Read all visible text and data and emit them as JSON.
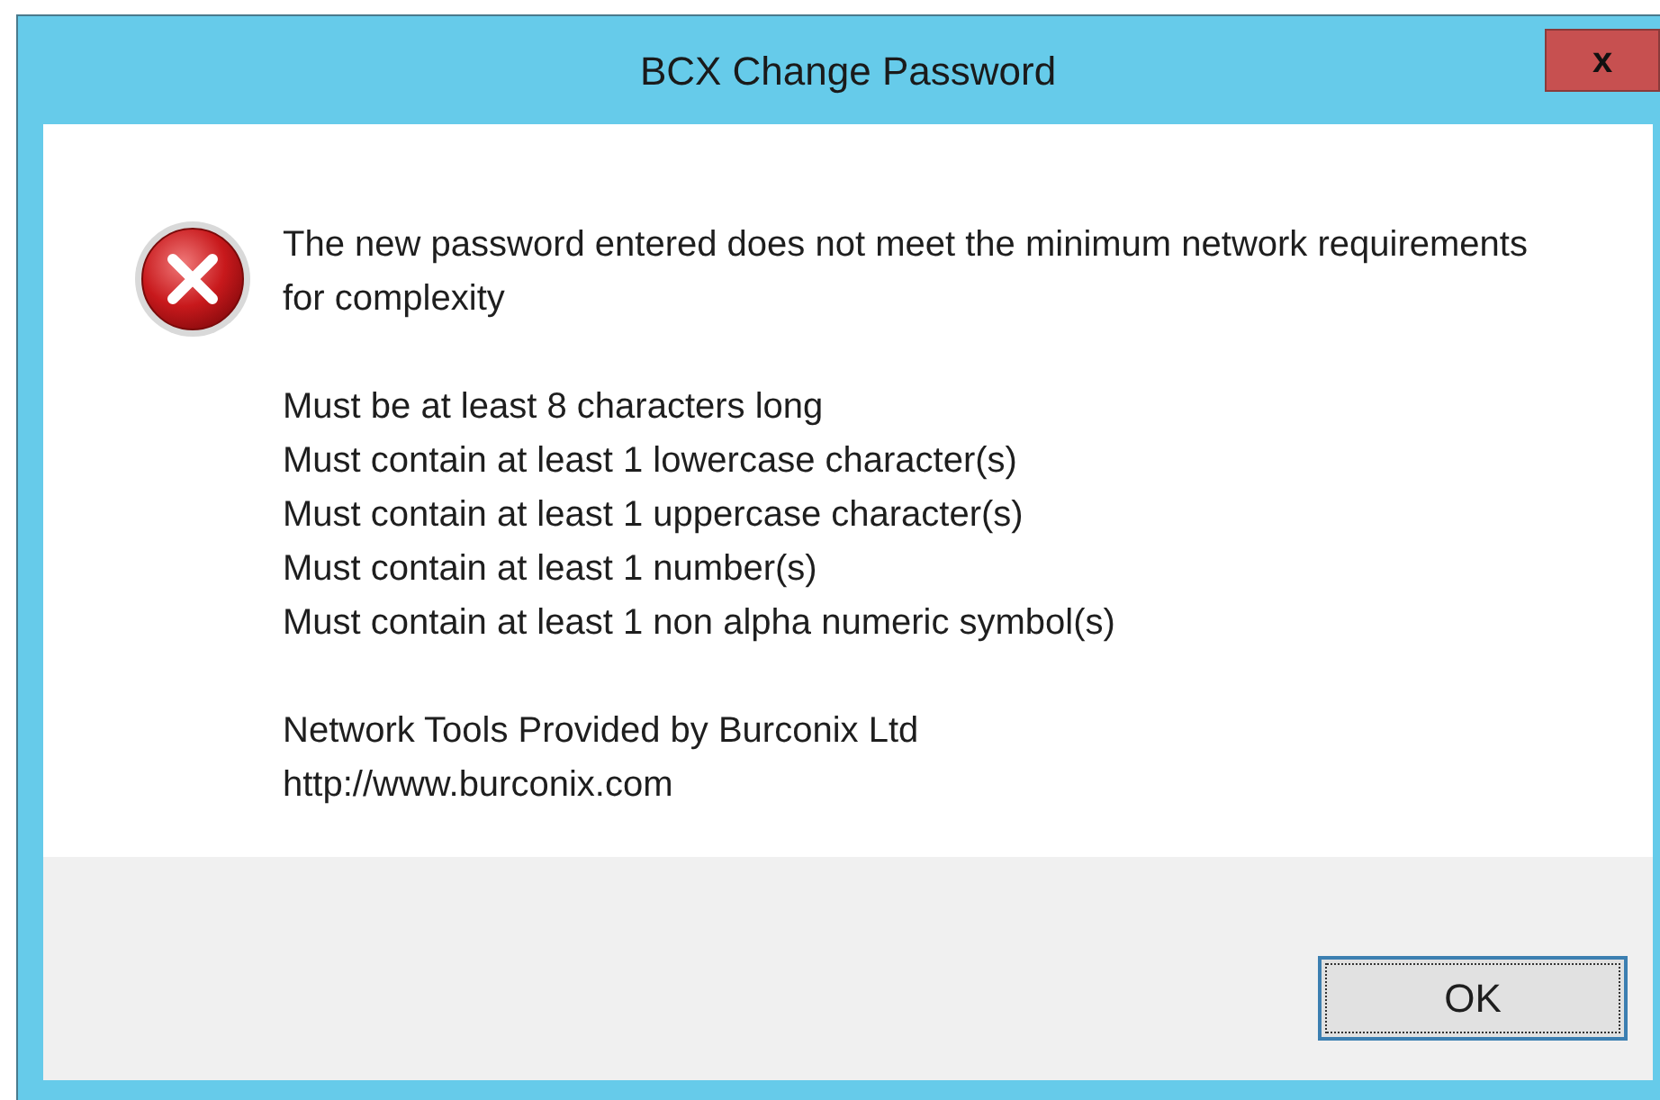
{
  "window": {
    "title": "BCX Change Password",
    "close": "x"
  },
  "message": {
    "kind": "error",
    "heading": "The new password entered does not meet the minimum network requirements for complexity",
    "requirements": [
      "Must be at least 8 characters long",
      "Must contain at least 1 lowercase character(s)",
      "Must contain at least 1 uppercase character(s)",
      "Must contain at least 1 number(s)",
      "Must contain at least 1 non alpha numeric symbol(s)"
    ],
    "footer": [
      "Network Tools Provided by Burconix Ltd",
      "http://www.burconix.com"
    ]
  },
  "buttons": [
    {
      "label": "OK",
      "selected": true
    }
  ]
}
